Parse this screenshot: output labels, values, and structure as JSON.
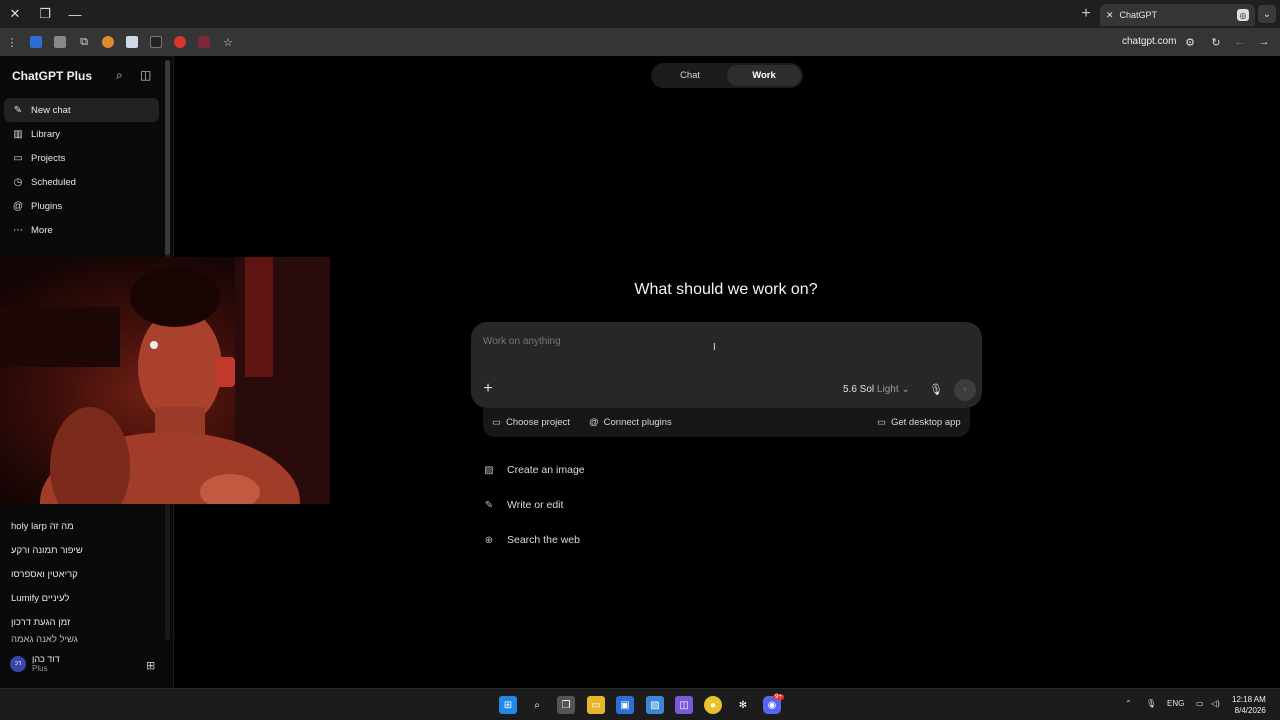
{
  "browser": {
    "tab_title": "ChatGPT",
    "url": "chatgpt.com"
  },
  "sidebar": {
    "brand": "ChatGPT Plus",
    "items": [
      {
        "label": "New chat",
        "icon": "edit-icon"
      },
      {
        "label": "Library",
        "icon": "library-icon"
      },
      {
        "label": "Projects",
        "icon": "folder-icon"
      },
      {
        "label": "Scheduled",
        "icon": "clock-icon"
      },
      {
        "label": "Plugins",
        "icon": "at-icon"
      },
      {
        "label": "More",
        "icon": "more-icon"
      }
    ],
    "history": [
      "holy larp מה זה",
      "שיפור תמונה ורקע",
      "קריאטין ואספרסו",
      "Lumify לעיניים",
      "זמן הגעת דרכון",
      "גשיל לאנה גאמה"
    ],
    "user": {
      "name": "דוד כהן",
      "initials": "דכ",
      "plan": "Plus"
    }
  },
  "main": {
    "modes": [
      "Chat",
      "Work"
    ],
    "active_mode": "Work",
    "headline": "What should we work on?",
    "composer": {
      "placeholder": "Work on anything",
      "model": "5.6 Sol",
      "model_variant": "Light"
    },
    "subbar": {
      "choose_project": "Choose project",
      "connect_plugins": "Connect plugins",
      "desktop_app": "Get desktop app"
    },
    "suggestions": [
      "Create an image",
      "Write or edit",
      "Search the web"
    ]
  },
  "taskbar": {
    "lang": "ENG",
    "time": "12:18 AM",
    "date": "8/4/2026",
    "discord_badge": "9+"
  },
  "colors": {
    "background": "#000000",
    "sidebar": "#0a0a0a",
    "composer": "#272727",
    "accent_avatar": "#3b47a8"
  }
}
